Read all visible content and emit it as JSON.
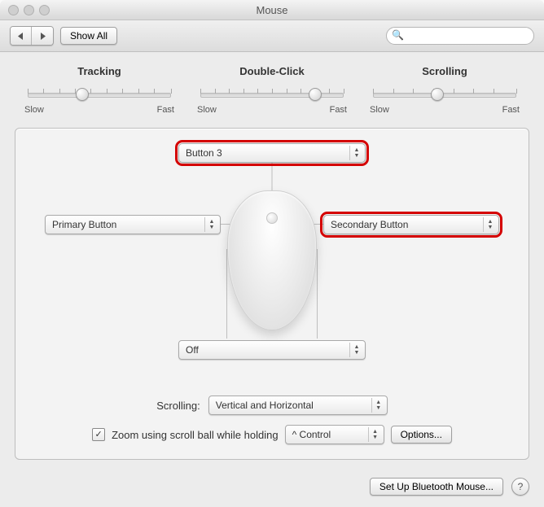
{
  "window": {
    "title": "Mouse"
  },
  "toolbar": {
    "show_all": "Show All",
    "search_placeholder": ""
  },
  "sliders": {
    "tracking": {
      "label": "Tracking",
      "slow": "Slow",
      "fast": "Fast",
      "pos": 38
    },
    "double_click": {
      "label": "Double-Click",
      "slow": "Slow",
      "fast": "Fast",
      "pos": 80
    },
    "scrolling": {
      "label": "Scrolling",
      "slow": "Slow",
      "fast": "Fast",
      "pos": 45
    }
  },
  "buttons": {
    "top": "Button 3",
    "left": "Primary Button",
    "right": "Secondary Button",
    "squeeze": "Off"
  },
  "scrolling_row": {
    "label": "Scrolling:",
    "value": "Vertical and Horizontal"
  },
  "zoom": {
    "label": "Zoom using scroll ball while holding",
    "modifier": "^ Control",
    "options": "Options..."
  },
  "footer": {
    "setup": "Set Up Bluetooth Mouse...",
    "help": "?"
  }
}
